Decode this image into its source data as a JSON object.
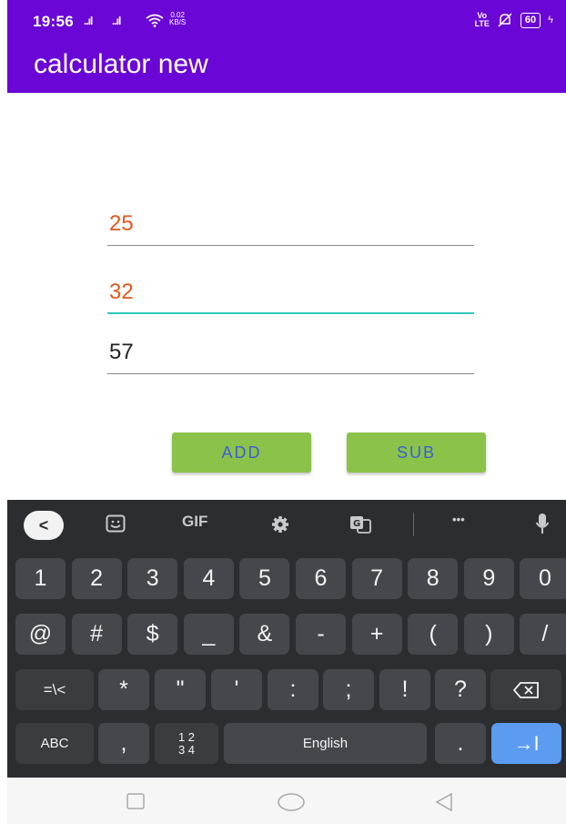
{
  "status_bar": {
    "time": "19:56",
    "signal_1": "..ıl",
    "signal_2": "..ıl",
    "wifi_icon": "wifi-icon",
    "speed_top": "0.02",
    "speed_bottom": "KB/S",
    "volte_top": "Vo",
    "volte_bottom": "LTE",
    "battery": "60"
  },
  "app_bar": {
    "title": "calculator new"
  },
  "form": {
    "first_number": "25",
    "second_number": "32",
    "result": "57"
  },
  "buttons": {
    "add_label": "ADD",
    "sub_label": "SUB"
  },
  "keyboard": {
    "toolbar": {
      "back": "<",
      "gif": "GIF",
      "more": "•••"
    },
    "row1": [
      "1",
      "2",
      "3",
      "4",
      "5",
      "6",
      "7",
      "8",
      "9",
      "0"
    ],
    "row2": [
      "@",
      "#",
      "$",
      "_",
      "&",
      "-",
      "+",
      "(",
      ")",
      "/"
    ],
    "row3": [
      "=\\<",
      "*",
      "\"",
      "'",
      ":",
      ";",
      "!",
      "?"
    ],
    "row4": {
      "abc": "ABC",
      "comma": ",",
      "numpad_top": "1 2",
      "numpad_bottom": "3 4",
      "space": "English",
      "period": ".",
      "enter": "→I"
    }
  },
  "colors": {
    "primary": "#6a06d6",
    "accent": "#2fc9bd",
    "button": "#8bc34a",
    "button_text": "#3b5fd6",
    "input_text": "#e2571d"
  }
}
